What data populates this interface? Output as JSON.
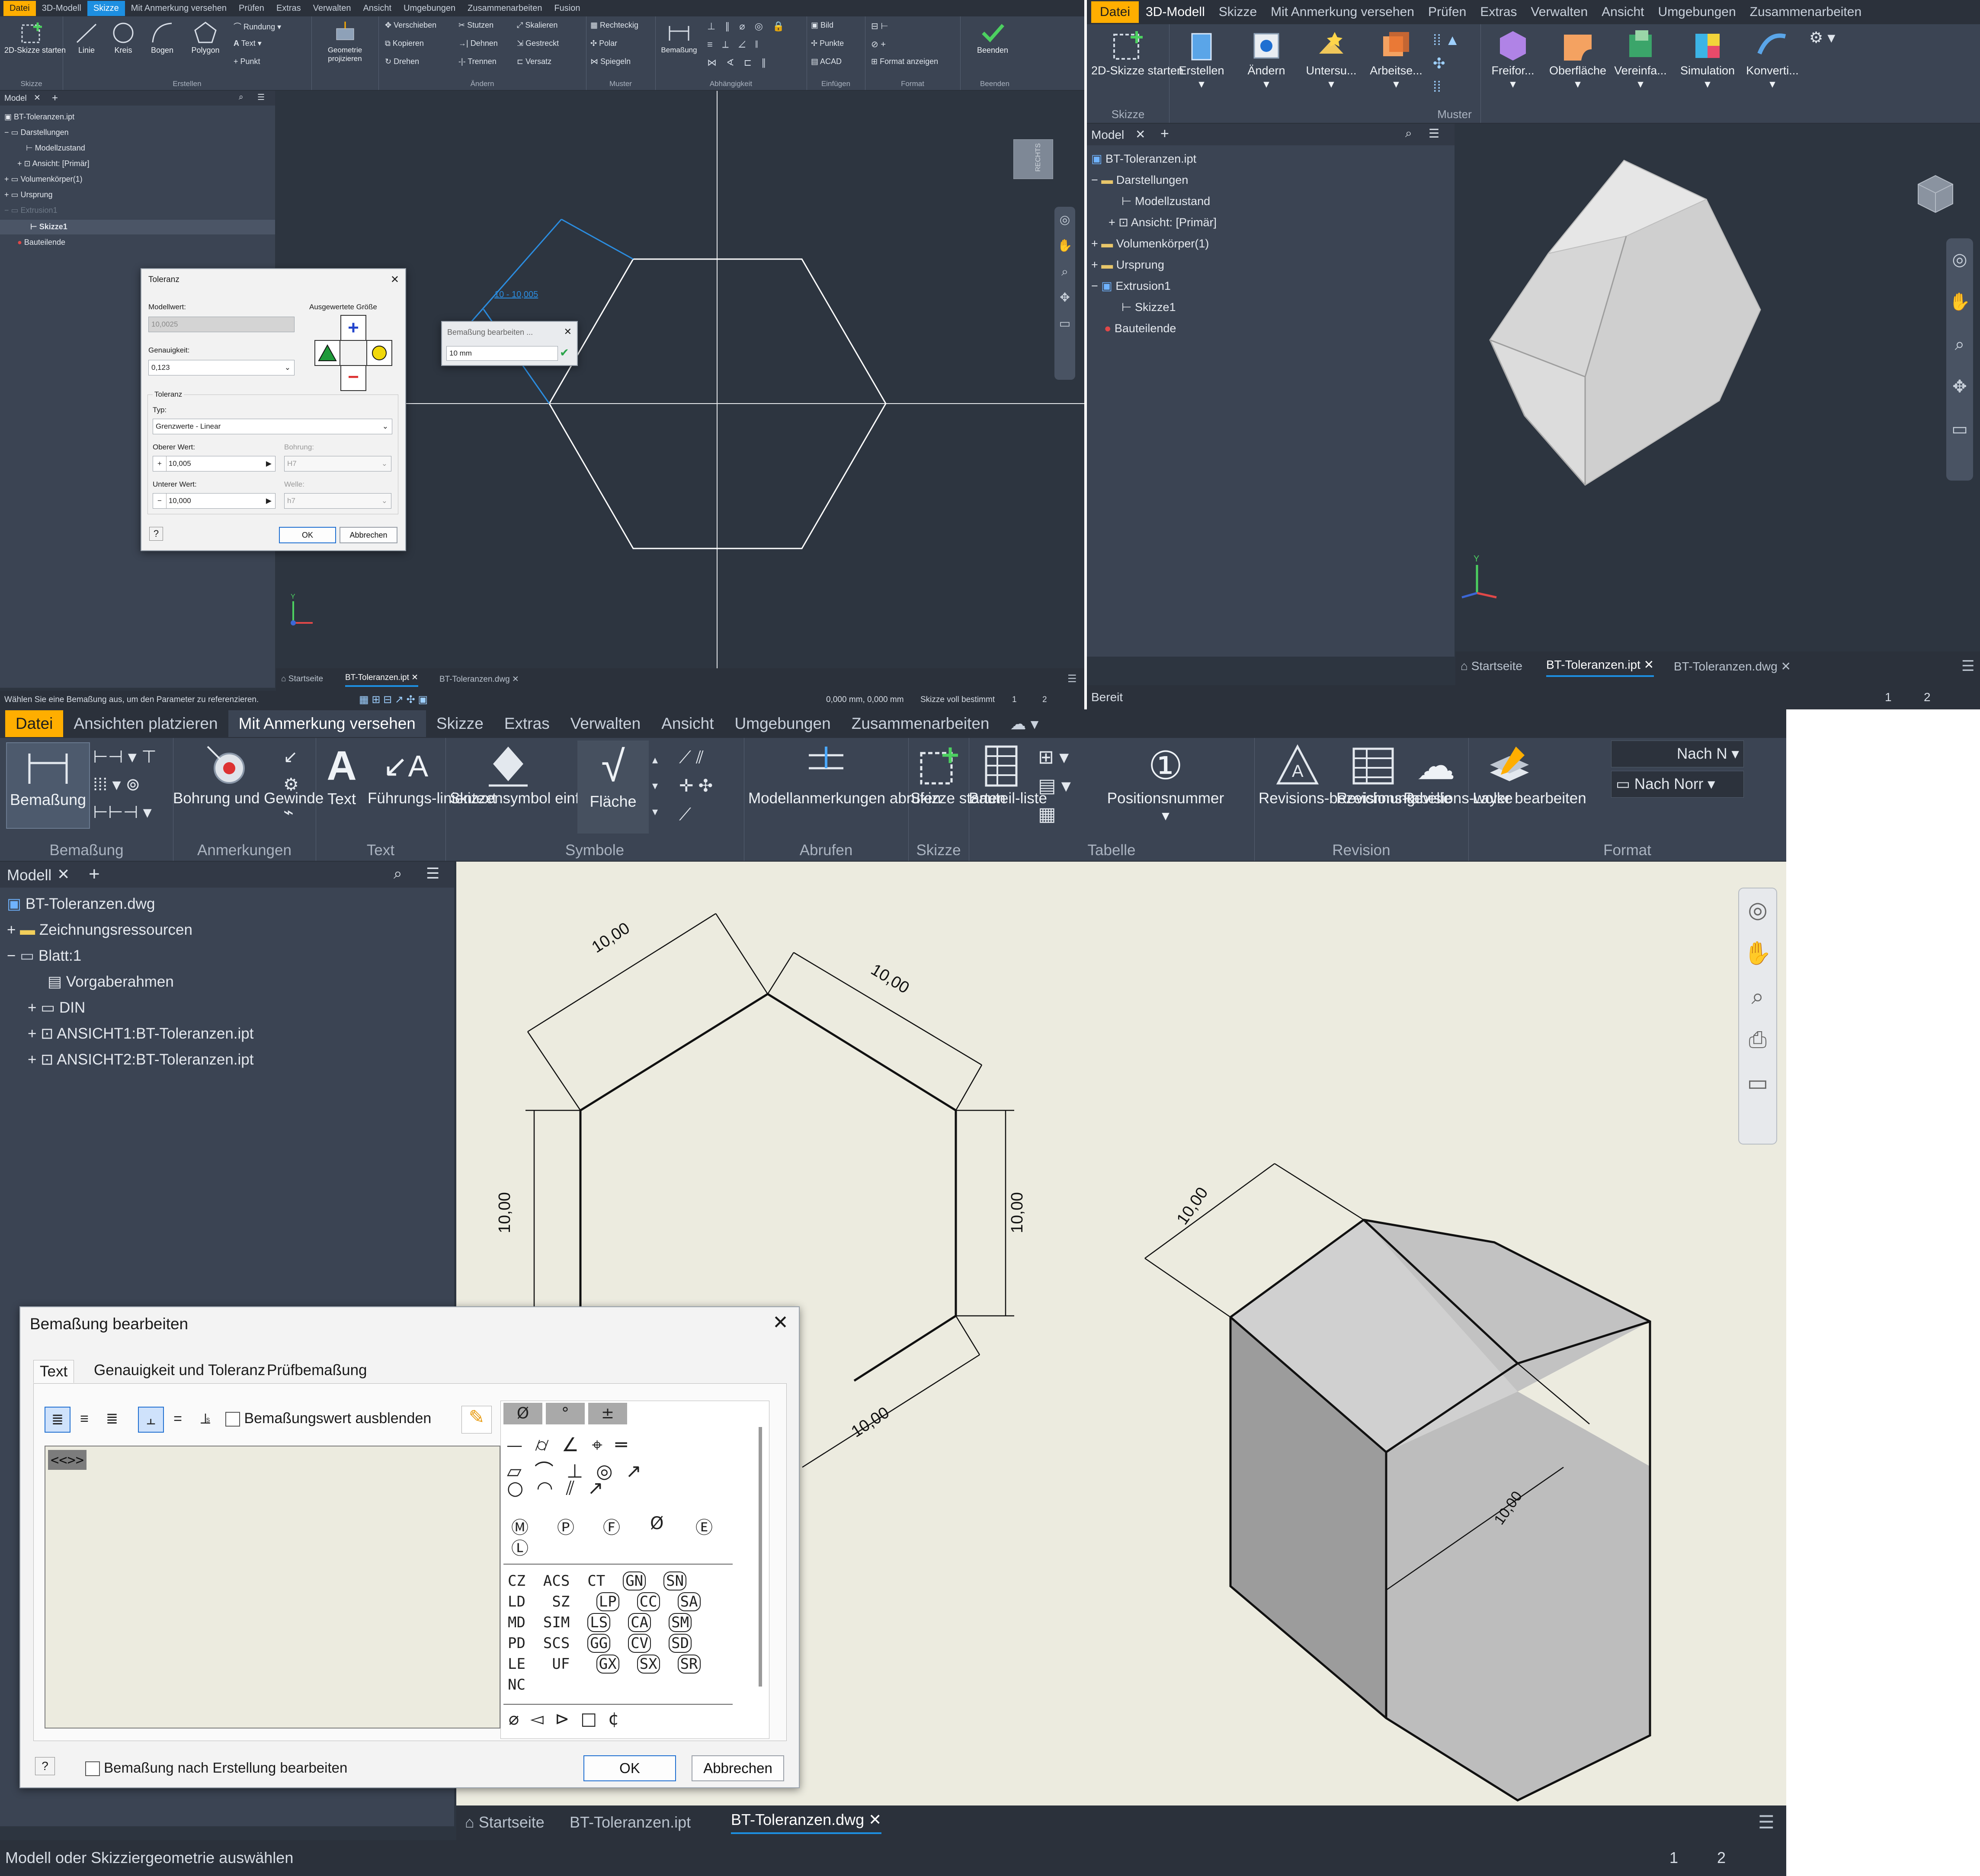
{
  "p1": {
    "menu": [
      "Datei",
      "3D-Modell",
      "Skizze",
      "Mit Anmerkung versehen",
      "Prüfen",
      "Extras",
      "Verwalten",
      "Ansicht",
      "Umgebungen",
      "Zusammenarbeiten",
      "Fusion"
    ],
    "active_tab": "Skizze",
    "ribbon": {
      "sketch_start": "2D-Skizze starten",
      "linie": "Linie",
      "kreis": "Kreis",
      "bogen": "Bogen",
      "polygon": "Polygon",
      "rundung": "Rundung",
      "text": "Text",
      "punkt": "Punkt",
      "geom": "Geometrie projizieren",
      "verschieben": "Verschieben",
      "kopieren": "Kopieren",
      "drehen": "Drehen",
      "stutzen": "Stutzen",
      "dehnen": "Dehnen",
      "trennen": "Trennen",
      "skalieren": "Skalieren",
      "gestreckt": "Gestreckt",
      "versatz": "Versatz",
      "rechteckig": "Rechteckig",
      "polar": "Polar",
      "spiegeln": "Spiegeln",
      "bemassung": "Bemaßung",
      "bild": "Bild",
      "punkte": "Punkte",
      "acad": "ACAD",
      "format_anzeigen": "Format anzeigen",
      "beenden": "Beenden",
      "groups": [
        "Skizze",
        "Erstellen",
        "Ändern",
        "Muster",
        "Abhängigkeit",
        "Einfügen",
        "Format",
        "Beenden"
      ]
    },
    "browser": {
      "title": "Model",
      "items": [
        "BT-Toleranzen.ipt",
        "Darstellungen",
        "Modellzustand",
        "Ansicht: [Primär]",
        "Volumenkörper(1)",
        "Ursprung",
        "Extrusion1",
        "Skizze1",
        "Bauteilende"
      ]
    },
    "viewcube_label": "RECHTS",
    "dim_text": "10 - 10,005",
    "edit_popup": {
      "title": "Bemaßung bearbeiten ...",
      "value": "10 mm"
    },
    "tol_dialog": {
      "title": "Toleranz",
      "modellwert_label": "Modellwert:",
      "modellwert": "10,0025",
      "ausgewertet": "Ausgewertete Größe",
      "genauigkeit_label": "Genauigkeit:",
      "genauigkeit": "0,123",
      "toleranz_group": "Toleranz",
      "typ_label": "Typ:",
      "typ": "Grenzwerte - Linear",
      "oberer_label": "Oberer Wert:",
      "oberer": "10,005",
      "bohrung_label": "Bohrung:",
      "bohrung": "H7",
      "unterer_label": "Unterer Wert:",
      "unterer": "10,000",
      "welle_label": "Welle:",
      "welle": "h7",
      "ok": "OK",
      "abbrechen": "Abbrechen"
    },
    "tabs": [
      "Startseite",
      "BT-Toleranzen.ipt",
      "BT-Toleranzen.dwg"
    ],
    "status_left": "Wählen Sie eine Bemaßung aus, um den Parameter zu referenzieren.",
    "status_coords": "0,000 mm, 0,000 mm",
    "status_sketch": "Skizze voll bestimmt",
    "status_nums": [
      "1",
      "2"
    ]
  },
  "p2": {
    "menu": [
      "Datei",
      "3D-Modell",
      "Skizze",
      "Mit Anmerkung versehen",
      "Prüfen",
      "Extras",
      "Verwalten",
      "Ansicht",
      "Umgebungen",
      "Zusammenarbeiten"
    ],
    "ribbon": [
      "2D-Skizze starten",
      "Erstellen",
      "Ändern",
      "Untersu...",
      "Arbeitse...",
      "Freifor...",
      "Oberfläche",
      "Vereinfa...",
      "Simulation",
      "Konverti..."
    ],
    "groups": [
      "Skizze",
      "Muster"
    ],
    "browser": {
      "title": "Model",
      "items": [
        "BT-Toleranzen.ipt",
        "Darstellungen",
        "Modellzustand",
        "Ansicht: [Primär]",
        "Volumenkörper(1)",
        "Ursprung",
        "Extrusion1",
        "Skizze1",
        "Bauteilende"
      ]
    },
    "tabs": [
      "Startseite",
      "BT-Toleranzen.ipt",
      "BT-Toleranzen.dwg"
    ],
    "status": "Bereit",
    "status_nums": [
      "1",
      "2"
    ]
  },
  "p3": {
    "menu": [
      "Datei",
      "Ansichten platzieren",
      "Mit Anmerkung versehen",
      "Skizze",
      "Extras",
      "Verwalten",
      "Ansicht",
      "Umgebungen",
      "Zusammenarbeiten"
    ],
    "ribbon": {
      "bemassung": "Bemaßung",
      "bohrung": "Bohrung und Gewinde",
      "text": "Text",
      "fuehrung": "Führungs-linientext",
      "skizzensymbol": "Skizzensymbol einfügen",
      "flaeche": "Fläche",
      "modellanm": "Modellanmerkungen abrufen",
      "skizze_starten": "Skizze starten",
      "bauteilliste": "Bauteil-liste",
      "positionsnummer": "Positionsnummer",
      "rev_bez": "Revisions-bezeichnung",
      "rev_tab": "Revisions-tabelle",
      "rev_wolke": "Revisions-wolke",
      "layer": "Layer bearbeiten",
      "nach_n": "Nach N",
      "nach_norm": "Nach Norr",
      "groups": [
        "Bemaßung",
        "Anmerkungen",
        "Text",
        "Symbole",
        "Abrufen",
        "Skizze",
        "Tabelle",
        "Revision",
        "Format"
      ]
    },
    "browser": {
      "title": "Modell",
      "items": [
        "BT-Toleranzen.dwg",
        "Zeichnungsressourcen",
        "Blatt:1",
        "Vorgaberahmen",
        "DIN",
        "ANSICHT1:BT-Toleranzen.ipt",
        "ANSICHT2:BT-Toleranzen.ipt"
      ]
    },
    "dims": [
      "10,00",
      "10,00",
      "10,00",
      "10,00",
      "10,00",
      "10,00",
      "10,00"
    ],
    "dialog": {
      "title": "Bemaßung bearbeiten",
      "tabs": [
        "Text",
        "Genauigkeit und Toleranz",
        "Prüfbemaßung"
      ],
      "hide_value": "Bemaßungswert ausblenden",
      "content": "<<>>",
      "sym_header": [
        "Ø",
        "°",
        "±"
      ],
      "mods": [
        "M",
        "P",
        "F",
        "Ø",
        "E",
        "L"
      ],
      "codes": [
        [
          "CZ",
          "ACS",
          "CT",
          "GN",
          "SN"
        ],
        [
          "LD",
          "SZ",
          "LP",
          "CC",
          "SA"
        ],
        [
          "MD",
          "SIM",
          "LS",
          "CA",
          "SM"
        ],
        [
          "PD",
          "SCS",
          "GG",
          "CV",
          "SD"
        ],
        [
          "LE",
          "UF",
          "GX",
          "SX",
          "SR"
        ],
        [
          "NC"
        ]
      ],
      "edit_after": "Bemaßung nach Erstellung bearbeiten",
      "ok": "OK",
      "abbrechen": "Abbrechen"
    },
    "tabs": [
      "Startseite",
      "BT-Toleranzen.ipt",
      "BT-Toleranzen.dwg"
    ],
    "status": "Modell oder Skizziergeometrie auswählen",
    "status_nums": [
      "1",
      "2"
    ]
  },
  "colors": {
    "accent": "#1d8fe1",
    "file_tab": "#ffae00",
    "ui_bg": "#3b4453",
    "dark_bg": "#2b313b",
    "paper": "#ecebdf"
  }
}
